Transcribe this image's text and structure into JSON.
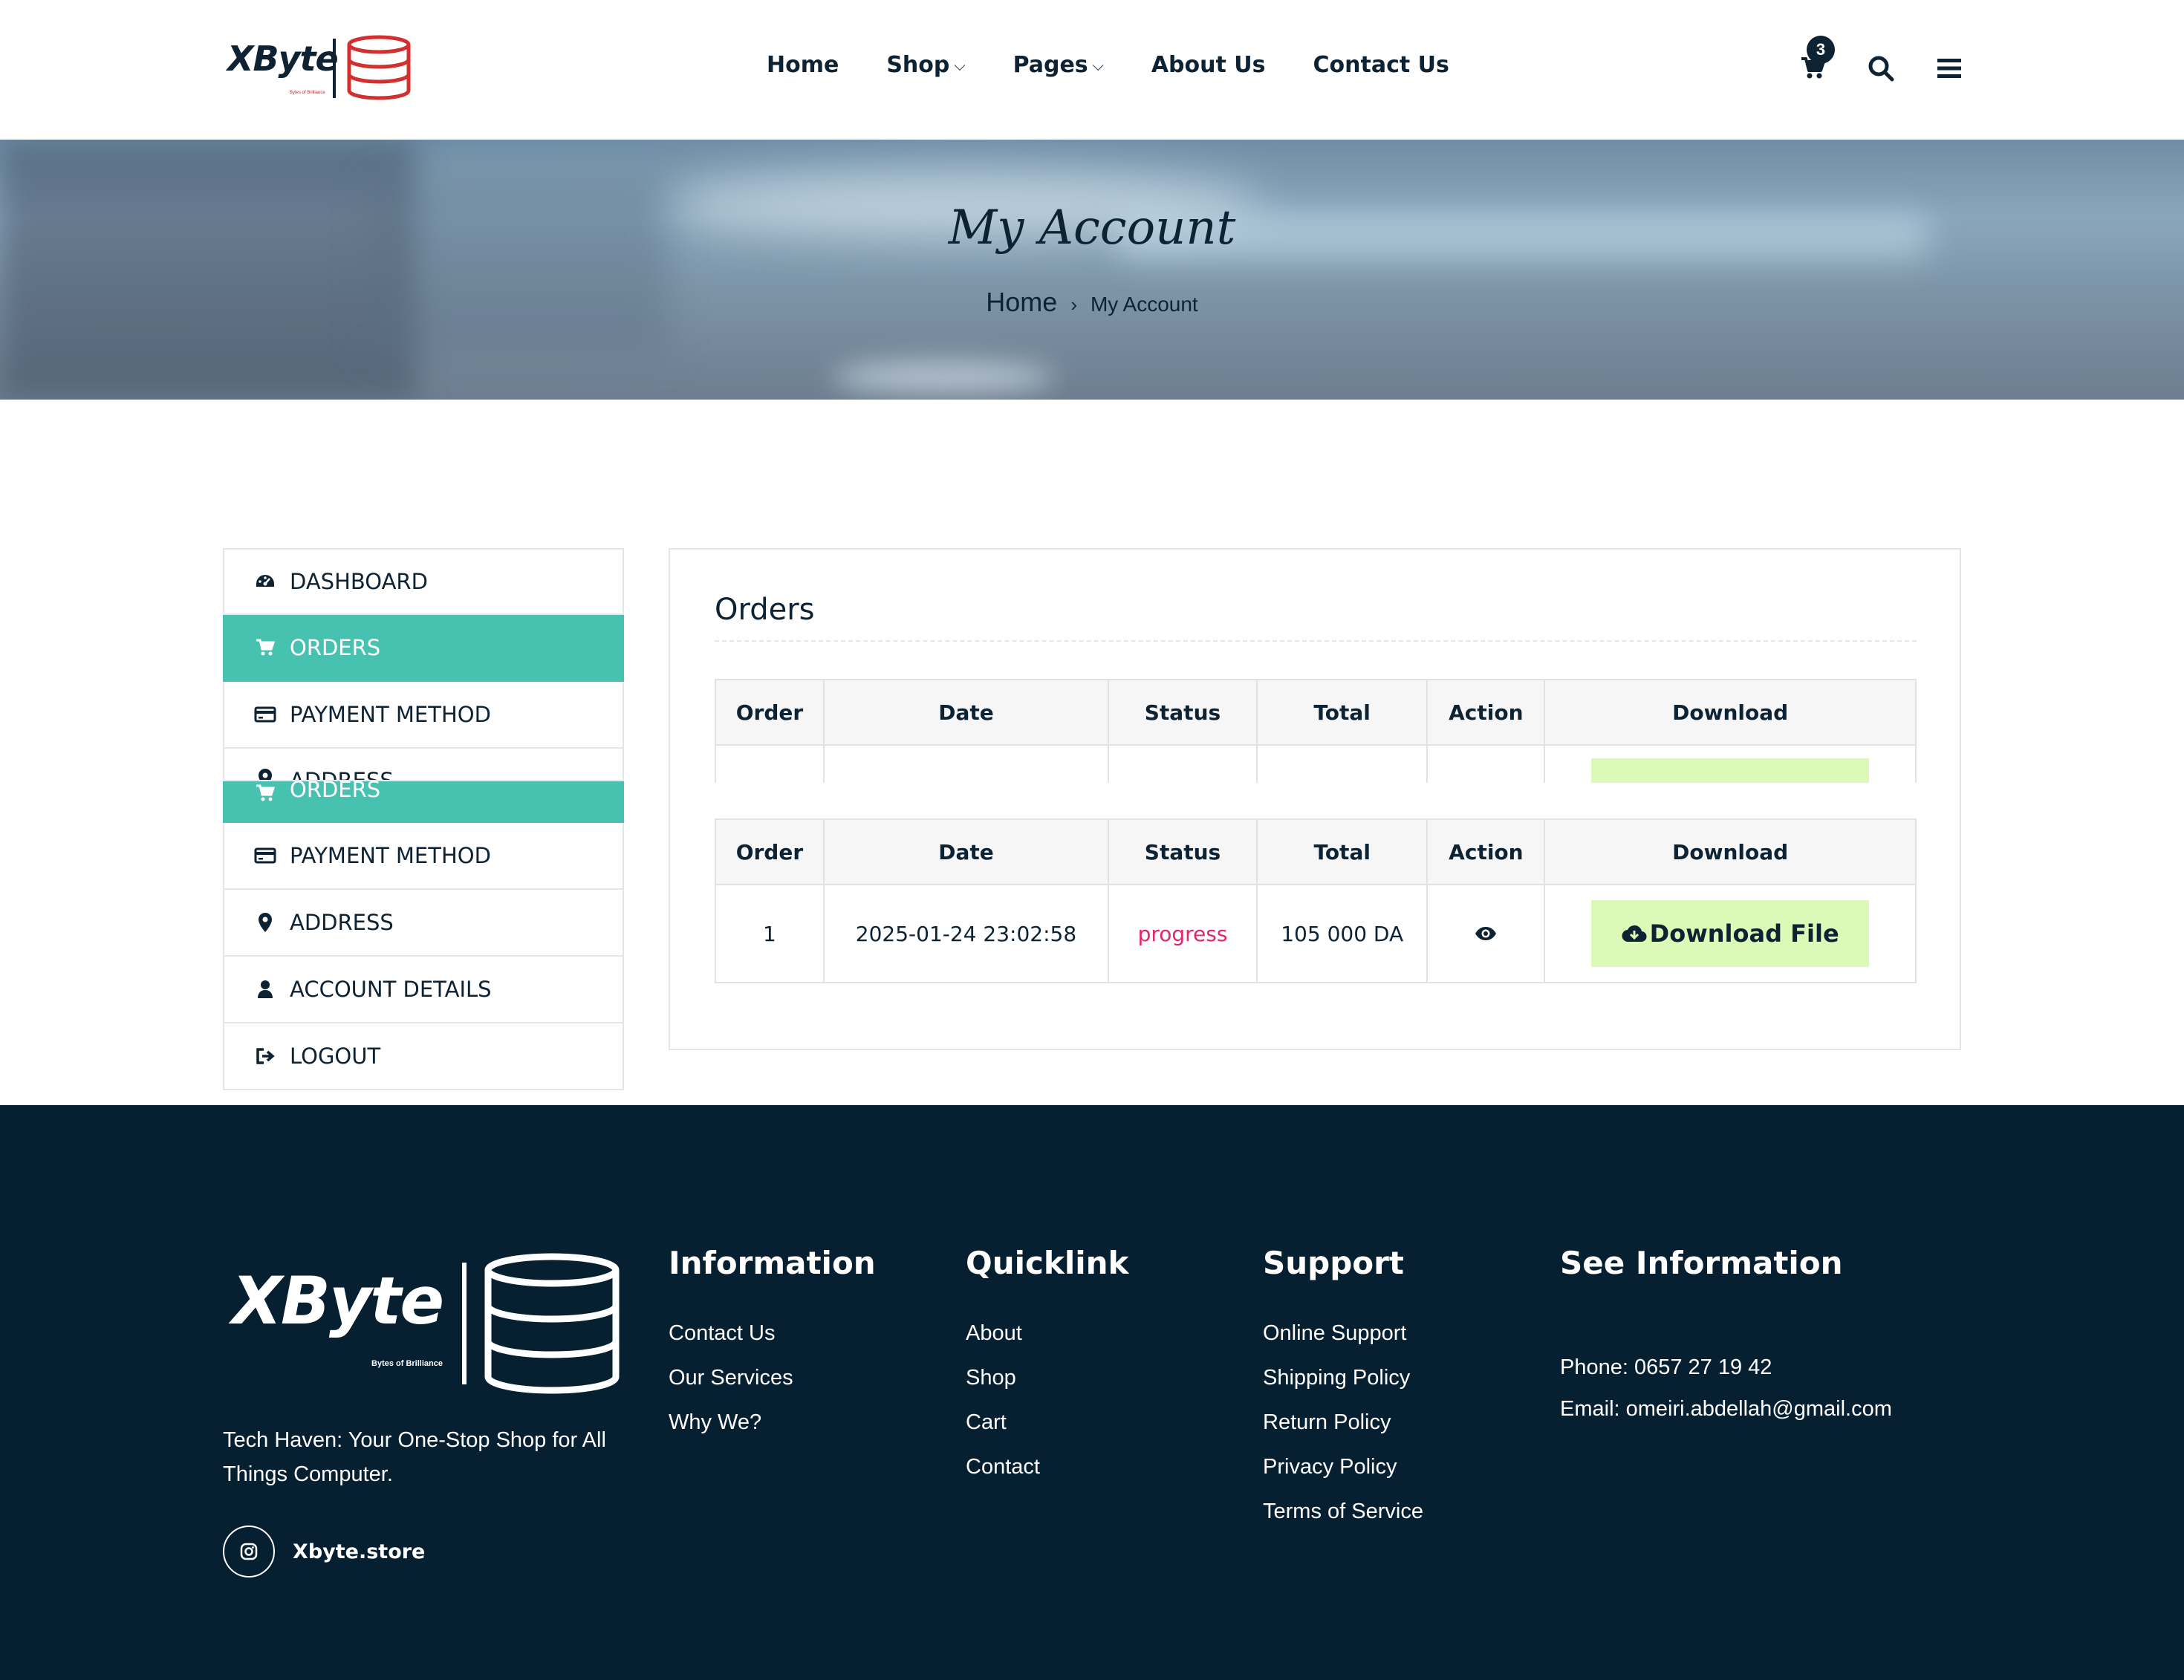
{
  "brand": {
    "name": "XByte",
    "tagline": "Bytes of Brilliance",
    "accent": "#c62828"
  },
  "nav": {
    "items": [
      {
        "label": "Home",
        "dropdown": false
      },
      {
        "label": "Shop",
        "dropdown": true
      },
      {
        "label": "Pages",
        "dropdown": true
      },
      {
        "label": "About Us",
        "dropdown": false
      },
      {
        "label": "Contact Us",
        "dropdown": false
      }
    ],
    "cart_count": "3",
    "icons": [
      "cart-icon",
      "search-icon",
      "menu-icon"
    ]
  },
  "hero": {
    "title": "My Account",
    "breadcrumb_home": "Home",
    "breadcrumb_sep": "›",
    "breadcrumb_current": "My Account"
  },
  "sidebar": {
    "active_color": "#47c2b0",
    "items": [
      {
        "label": "DASHBOARD",
        "icon": "dashboard-icon"
      },
      {
        "label": "ORDERS",
        "icon": "cart-icon",
        "active": true
      },
      {
        "label": "PAYMENT METHOD",
        "icon": "credit-card-icon"
      },
      {
        "label": "ADDRESS",
        "icon": "map-marker-icon"
      },
      {
        "label": "ORDERS",
        "icon": "cart-icon",
        "active": true
      },
      {
        "label": "PAYMENT METHOD",
        "icon": "credit-card-icon"
      },
      {
        "label": "ADDRESS",
        "icon": "map-marker-icon"
      },
      {
        "label": "ACCOUNT DETAILS",
        "icon": "user-icon"
      },
      {
        "label": "LOGOUT",
        "icon": "sign-out-icon"
      }
    ]
  },
  "orders": {
    "title": "Orders",
    "columns": [
      "Order",
      "Date",
      "Status",
      "Total",
      "Action",
      "Download"
    ],
    "rows": [
      {
        "order": "1",
        "date": "2025-01-24 23:02:58",
        "status": "progress",
        "total": "105 000 DA",
        "action_icon": "eye-icon",
        "download_label": "Download File"
      }
    ],
    "status_color": "#e3246e",
    "button_color": "#dcf9b8"
  },
  "footer": {
    "about": "Tech Haven: Your One-Stop Shop for All Things Computer.",
    "social_handle": "Xbyte.store",
    "social_icon": "instagram-icon",
    "information": {
      "title": "Information",
      "links": [
        "Contact Us",
        "Our Services",
        "Why We?"
      ]
    },
    "quicklink": {
      "title": "Quicklink",
      "links": [
        "About",
        "Shop",
        "Cart",
        "Contact"
      ]
    },
    "support": {
      "title": "Support",
      "links": [
        "Online Support",
        "Shipping Policy",
        "Return Policy",
        "Privacy Policy",
        "Terms of Service"
      ]
    },
    "see_info": {
      "title": "See Information",
      "phone": "Phone: 0657 27 19 42",
      "email": "Email: omeiri.abdellah@gmail.com"
    },
    "background": "#062032"
  }
}
